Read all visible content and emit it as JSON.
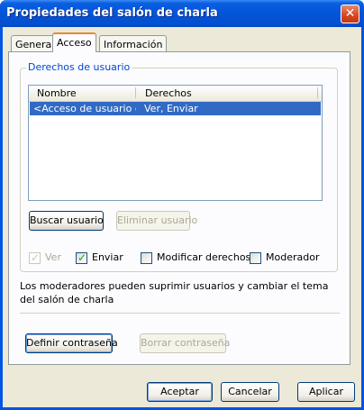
{
  "window": {
    "title": "Propiedades del salón de charla",
    "close_glyph": "✕"
  },
  "tabs": [
    {
      "label": "General",
      "active": false
    },
    {
      "label": "Acceso",
      "active": true
    },
    {
      "label": "Información",
      "active": false
    }
  ],
  "group": {
    "label": "Derechos de usuario",
    "list": {
      "columns": [
        "Nombre",
        "Derechos"
      ],
      "rows": [
        {
          "name": "<Acceso de usuario g...",
          "rights": "Ver, Enviar",
          "selected": true
        }
      ]
    },
    "buttons": {
      "find_user": "Buscar usuario",
      "remove_user": "Eliminar usuario"
    },
    "checkboxes": [
      {
        "label": "Ver",
        "checked": true,
        "enabled": false
      },
      {
        "label": "Enviar",
        "checked": true,
        "enabled": true
      },
      {
        "label": "Modificar derechos",
        "checked": false,
        "enabled": true
      },
      {
        "label": "Moderador",
        "checked": false,
        "enabled": true
      }
    ]
  },
  "info_text": "Los moderadores pueden suprimir usuarios y cambiar el tema del salón de charla",
  "password_buttons": {
    "set": "Definir contraseña",
    "clear": "Borrar contraseña"
  },
  "footer": {
    "ok": "Aceptar",
    "cancel": "Cancelar",
    "apply": "Aplicar"
  },
  "colors": {
    "titlebar": "#0454d8",
    "group_label": "#0046d5",
    "selection": "#316ac5",
    "check": "#21a121"
  }
}
